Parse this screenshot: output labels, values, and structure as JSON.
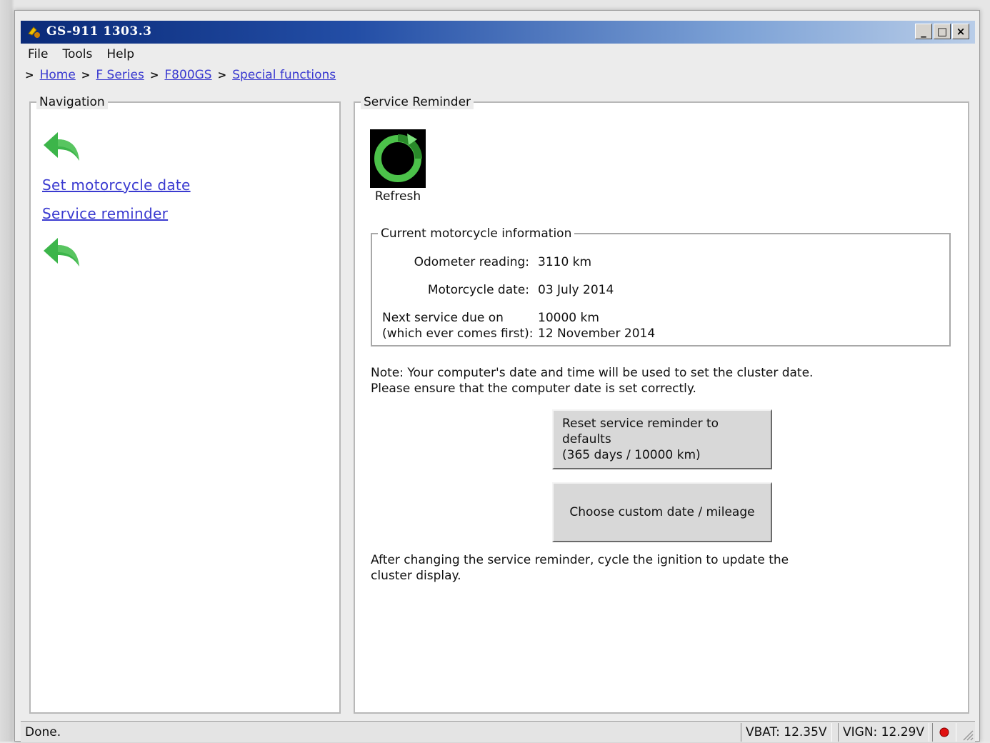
{
  "window": {
    "title": "GS-911 1303.3",
    "minimize_label": "_",
    "maximize_label": "□",
    "close_label": "×"
  },
  "menu": [
    "File",
    "Tools",
    "Help"
  ],
  "breadcrumb": {
    "separator": ">",
    "items": [
      "Home",
      "F Series",
      "F800GS",
      "Special functions"
    ]
  },
  "navigation": {
    "legend": "Navigation",
    "links": [
      "Set motorcycle date",
      "Service reminder"
    ]
  },
  "service_reminder": {
    "legend": "Service Reminder",
    "refresh_label": "Refresh",
    "info": {
      "legend": "Current motorcycle information",
      "odometer_label": "Odometer reading:",
      "odometer_value": "3110 km",
      "date_label": "Motorcycle date:",
      "date_value": "03 July 2014",
      "next_label_1": "Next service due on",
      "next_label_2": "(which ever comes first):",
      "next_value_1": "10000 km",
      "next_value_2": "12 November 2014"
    },
    "note_line_1": "Note: Your computer's date and time will be used to set the cluster date.",
    "note_line_2": "Please ensure that the computer date is set correctly.",
    "reset_button_line_1": "Reset service reminder to defaults",
    "reset_button_line_2": "(365 days / 10000 km)",
    "custom_button": "Choose custom date / mileage",
    "after_line_1": "After changing the service reminder, cycle the ignition to update the",
    "after_line_2": "cluster display."
  },
  "status": {
    "text": "Done.",
    "vbat": "VBAT: 12.35V",
    "vign": "VIGN: 12.29V",
    "connection_color": "#e01010"
  },
  "colors": {
    "arrow_green": "#3cb54a",
    "link_blue": "#3a3ad0",
    "title_dark": "#0a2a78"
  }
}
